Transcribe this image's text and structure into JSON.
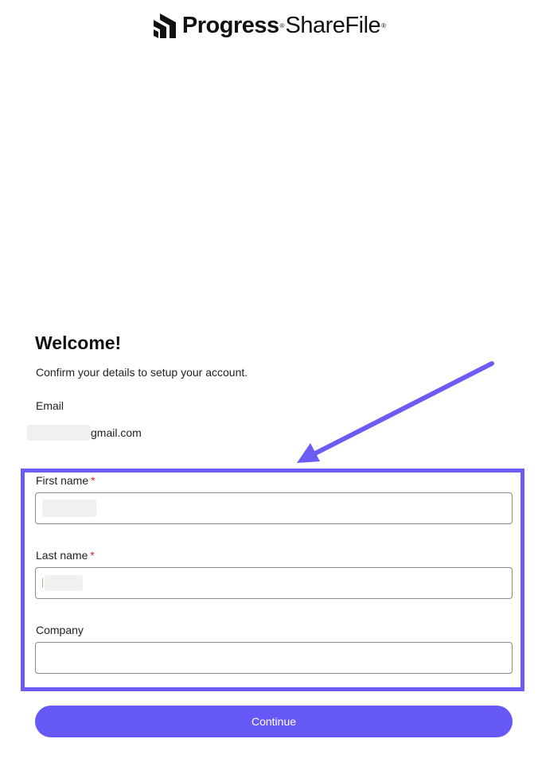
{
  "brand": {
    "progress": "Progress",
    "sharefile": "ShareFile",
    "registered": "®"
  },
  "welcome": {
    "title": "Welcome!",
    "subtitle": "Confirm your details to setup your account."
  },
  "email": {
    "label": "Email",
    "value_suffix": "gmail.com"
  },
  "form": {
    "first_name": {
      "label": "First name",
      "required_mark": "*",
      "value": ""
    },
    "last_name": {
      "label": "Last name",
      "required_mark": "*",
      "value": ""
    },
    "company": {
      "label": "Company",
      "value": ""
    }
  },
  "actions": {
    "continue_label": "Continue"
  },
  "colors": {
    "accent": "#6558f5",
    "highlight": "#6a5cf5",
    "required": "#d92020"
  }
}
